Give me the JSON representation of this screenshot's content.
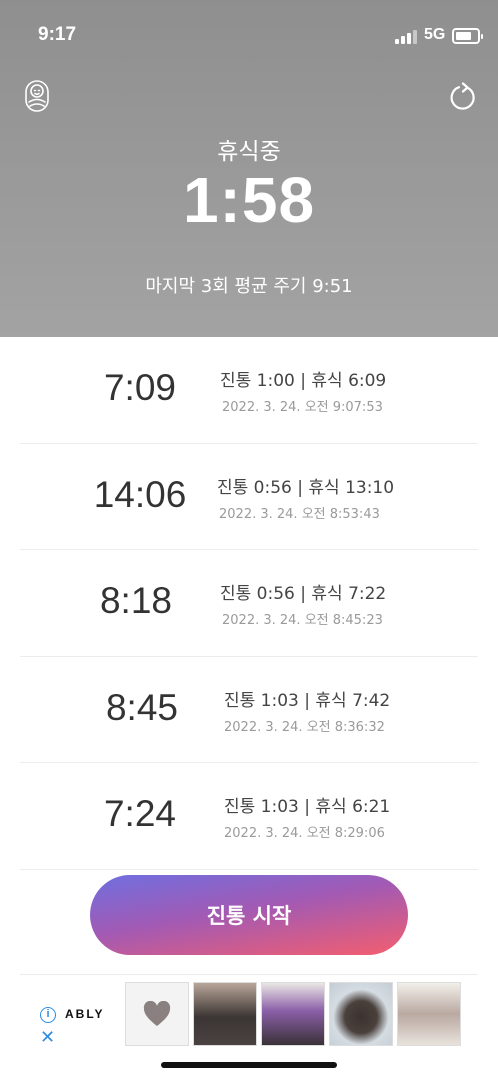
{
  "status_bar": {
    "time": "9:17",
    "network": "5G",
    "battery_level": 0.75
  },
  "header": {
    "state_label": "휴식중",
    "timer": "1:58",
    "average_cycle": "마지막 3회 평균 주기 9:51",
    "left_icon": "baby-icon",
    "right_icon": "reset-icon"
  },
  "records": [
    {
      "interval": "7:09",
      "detail": "진통 1:00 | 휴식 6:09",
      "timestamp": "2022. 3. 24. 오전 9:07:53"
    },
    {
      "interval": "14:06",
      "detail": "진통 0:56 | 휴식 13:10",
      "timestamp": "2022. 3. 24. 오전 8:53:43"
    },
    {
      "interval": "8:18",
      "detail": "진통 0:56 | 휴식 7:22",
      "timestamp": "2022. 3. 24. 오전 8:45:23"
    },
    {
      "interval": "8:45",
      "detail": "진통 1:03 | 휴식 7:42",
      "timestamp": "2022. 3. 24. 오전 8:36:32"
    },
    {
      "interval": "7:24",
      "detail": "진통 1:03 | 휴식 6:21",
      "timestamp": "2022. 3. 24. 오전 8:29:06"
    }
  ],
  "start_button": {
    "label": "진통 시작"
  },
  "ad": {
    "brand": "ABLY",
    "info_icon": "info-icon",
    "close_icon": "close-icon",
    "thumbnails": [
      "heart-icon",
      "product-image",
      "product-image",
      "product-image",
      "product-image"
    ]
  },
  "colors": {
    "header_top": "#8f8f8f",
    "header_bottom": "#a3a3a3",
    "button_gradient_start": "#6f6fe0",
    "button_gradient_end": "#f45e6e",
    "ad_accent": "#2f8de4"
  }
}
